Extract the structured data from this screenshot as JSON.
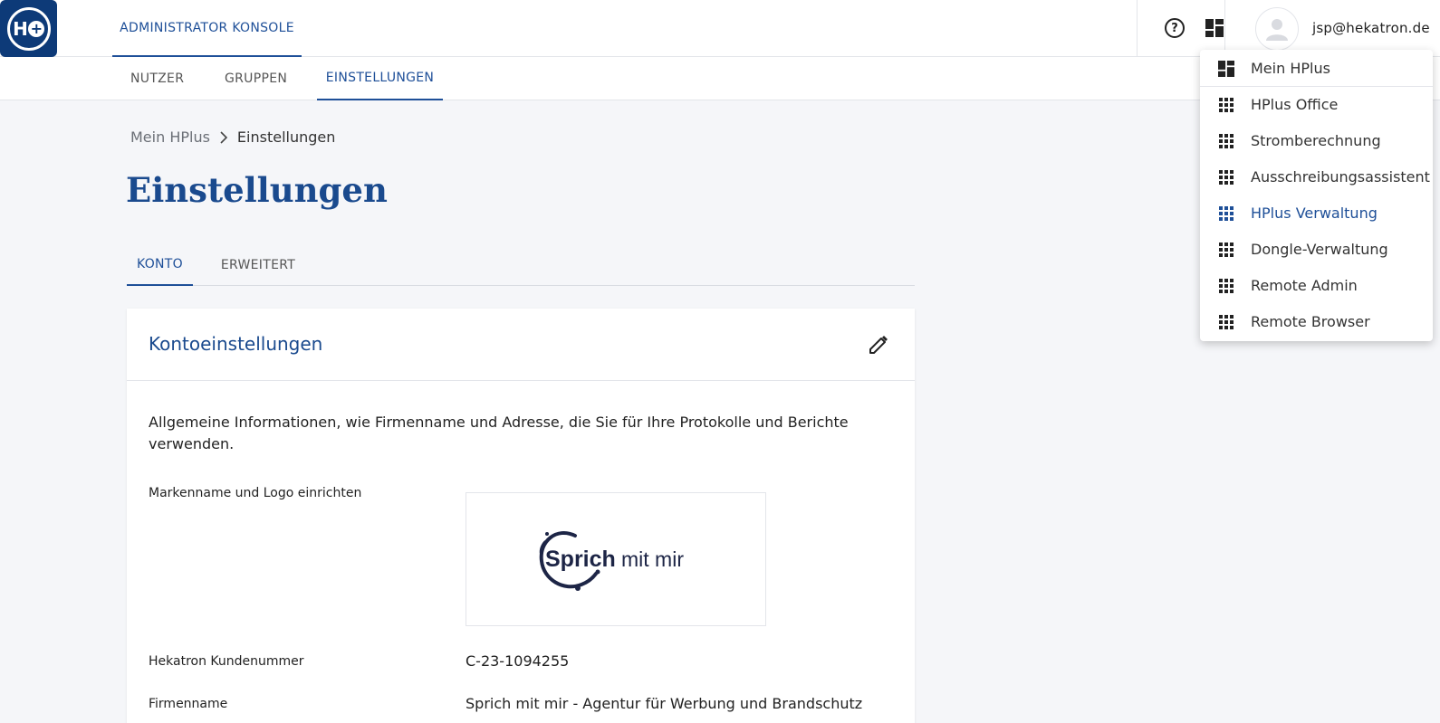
{
  "header": {
    "logo_text": "H",
    "logo_plus": "+",
    "console_tab": "ADMINISTRATOR KONSOLE",
    "user_email": "jsp@hekatron.de",
    "help_glyph": "?",
    "icons": [
      "help-icon",
      "dashboard-icon",
      "avatar-icon"
    ]
  },
  "subnav": {
    "items": [
      "NUTZER",
      "GRUPPEN",
      "EINSTELLUNGEN"
    ],
    "active": "EINSTELLUNGEN"
  },
  "breadcrumb": {
    "root": "Mein HPlus",
    "separator": ">",
    "current": "Einstellungen"
  },
  "page_title": "Einstellungen",
  "tabs": {
    "items": [
      "KONTO",
      "ERWEITERT"
    ],
    "active": "KONTO"
  },
  "card": {
    "title": "Kontoeinstellungen",
    "description": "Allgemeine Informationen, wie Firmenname und Adresse, die Sie für Ihre Protokolle und Berichte verwenden.",
    "fields": [
      {
        "label": "Markenname und Logo einrichten",
        "value": ""
      },
      {
        "label": "Hekatron Kundenummer",
        "value": "C-23-1094255"
      },
      {
        "label": "Firmenname",
        "value": "Sprich mit mir - Agentur für Werbung und Brandschutz"
      }
    ],
    "brand_logo": {
      "word1": "Sprich",
      "word2": "mit mir"
    }
  },
  "app_menu": {
    "items": [
      {
        "label": "Mein HPlus",
        "icon": "dashboard-icon"
      },
      {
        "label": "HPlus Office",
        "icon": "apps-grid-icon"
      },
      {
        "label": "Stromberechnung",
        "icon": "apps-grid-icon"
      },
      {
        "label": "Ausschreibungsassistent",
        "icon": "apps-grid-icon"
      },
      {
        "label": "HPlus Verwaltung",
        "icon": "apps-grid-icon"
      },
      {
        "label": "Dongle-Verwaltung",
        "icon": "apps-grid-icon"
      },
      {
        "label": "Remote Admin",
        "icon": "apps-grid-icon"
      },
      {
        "label": "Remote Browser",
        "icon": "apps-grid-icon"
      }
    ],
    "highlighted": "HPlus Verwaltung"
  },
  "colors": {
    "brand_blue": "#1e4f98",
    "logo_bg": "#0d3a78",
    "brand_logo_ink": "#1d2546"
  }
}
